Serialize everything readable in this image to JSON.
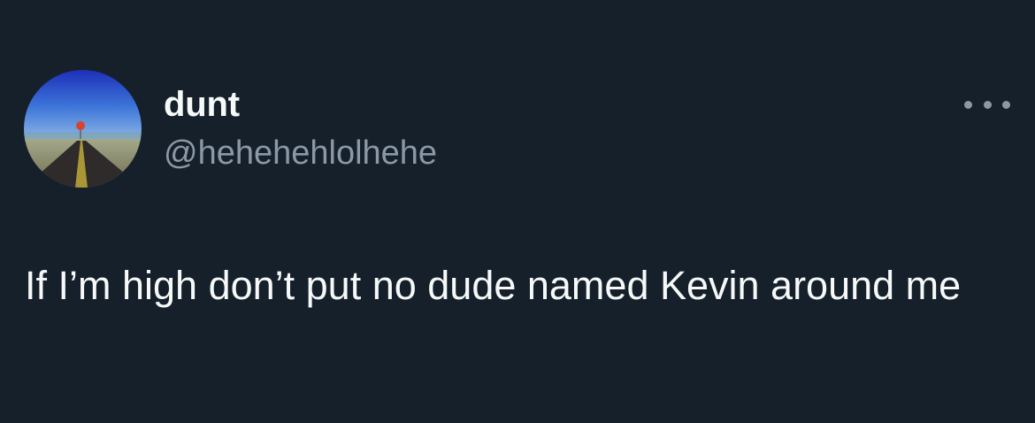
{
  "author": {
    "display_name": "dunt",
    "handle": "@hehehehlolhehe",
    "avatar_icon": "avatar-road-balloon"
  },
  "menu": {
    "icon": "more-options-icon"
  },
  "tweet": {
    "text": "If I’m high don’t put no dude named Kevin around me"
  },
  "colors": {
    "background": "#15202b",
    "primary_text": "#f7f9f9",
    "secondary_text": "#8b98a5"
  }
}
